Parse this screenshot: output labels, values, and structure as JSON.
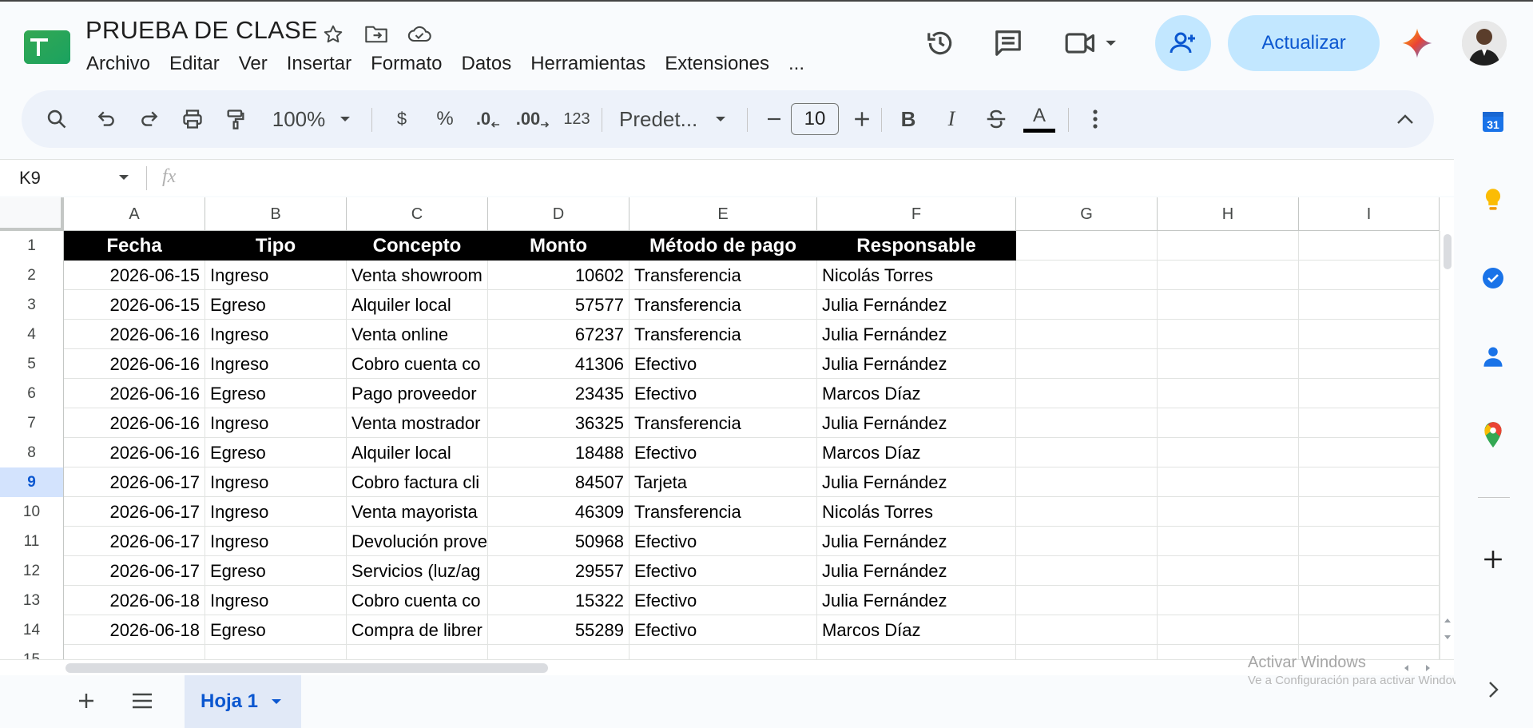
{
  "header": {
    "title": "PRUEBA DE CLASE",
    "menus": [
      "Archivo",
      "Editar",
      "Ver",
      "Insertar",
      "Formato",
      "Datos",
      "Herramientas",
      "Extensiones",
      "..."
    ],
    "update_label": "Actualizar"
  },
  "toolbar": {
    "zoom": "100%",
    "currency": "$",
    "percent": "%",
    "dec_decrease": ".0",
    "dec_increase": ".00",
    "number_format": "123",
    "font_name": "Predet...",
    "font_size": "10",
    "bold": "B",
    "italic": "I",
    "text_color_letter": "A"
  },
  "formula_bar": {
    "cell_ref": "K9",
    "fx": "fx"
  },
  "grid": {
    "columns": [
      "A",
      "B",
      "C",
      "D",
      "E",
      "F",
      "G",
      "H",
      "I"
    ],
    "selected_row": 9,
    "headers": [
      "Fecha",
      "Tipo",
      "Concepto",
      "Monto",
      "Método de pago",
      "Responsable"
    ],
    "rows": [
      [
        "2026-06-15",
        "Ingreso",
        "Venta showroom",
        "10602",
        "Transferencia",
        "Nicolás Torres"
      ],
      [
        "2026-06-15",
        "Egreso",
        "Alquiler local",
        "57577",
        "Transferencia",
        "Julia Fernández"
      ],
      [
        "2026-06-16",
        "Ingreso",
        "Venta online",
        "67237",
        "Transferencia",
        "Julia Fernández"
      ],
      [
        "2026-06-16",
        "Ingreso",
        "Cobro cuenta co",
        "41306",
        "Efectivo",
        "Julia Fernández"
      ],
      [
        "2026-06-16",
        "Egreso",
        "Pago proveedor",
        "23435",
        "Efectivo",
        "Marcos Díaz"
      ],
      [
        "2026-06-16",
        "Ingreso",
        "Venta mostrador",
        "36325",
        "Transferencia",
        "Julia Fernández"
      ],
      [
        "2026-06-16",
        "Egreso",
        "Alquiler local",
        "18488",
        "Efectivo",
        "Marcos Díaz"
      ],
      [
        "2026-06-17",
        "Ingreso",
        "Cobro factura cli",
        "84507",
        "Tarjeta",
        "Julia Fernández"
      ],
      [
        "2026-06-17",
        "Ingreso",
        "Venta mayorista",
        "46309",
        "Transferencia",
        "Nicolás Torres"
      ],
      [
        "2026-06-17",
        "Ingreso",
        "Devolución prove",
        "50968",
        "Efectivo",
        "Julia Fernández"
      ],
      [
        "2026-06-17",
        "Egreso",
        "Servicios (luz/ag",
        "29557",
        "Efectivo",
        "Julia Fernández"
      ],
      [
        "2026-06-18",
        "Ingreso",
        "Cobro cuenta co",
        "15322",
        "Efectivo",
        "Julia Fernández"
      ],
      [
        "2026-06-18",
        "Egreso",
        "Compra de librer",
        "55289",
        "Efectivo",
        "Marcos Díaz"
      ]
    ]
  },
  "sheets": {
    "active": "Hoja 1"
  },
  "watermark": {
    "line1": "Activar Windows",
    "line2": "Ve a Configuración para activar Windows."
  },
  "side_panel": {
    "calendar_day": "31"
  },
  "colors": {
    "accent": "#0b57d0",
    "chip_bg": "#c2e7ff",
    "toolbar_bg": "#edf2fa",
    "header_cell_bg": "#000000"
  }
}
